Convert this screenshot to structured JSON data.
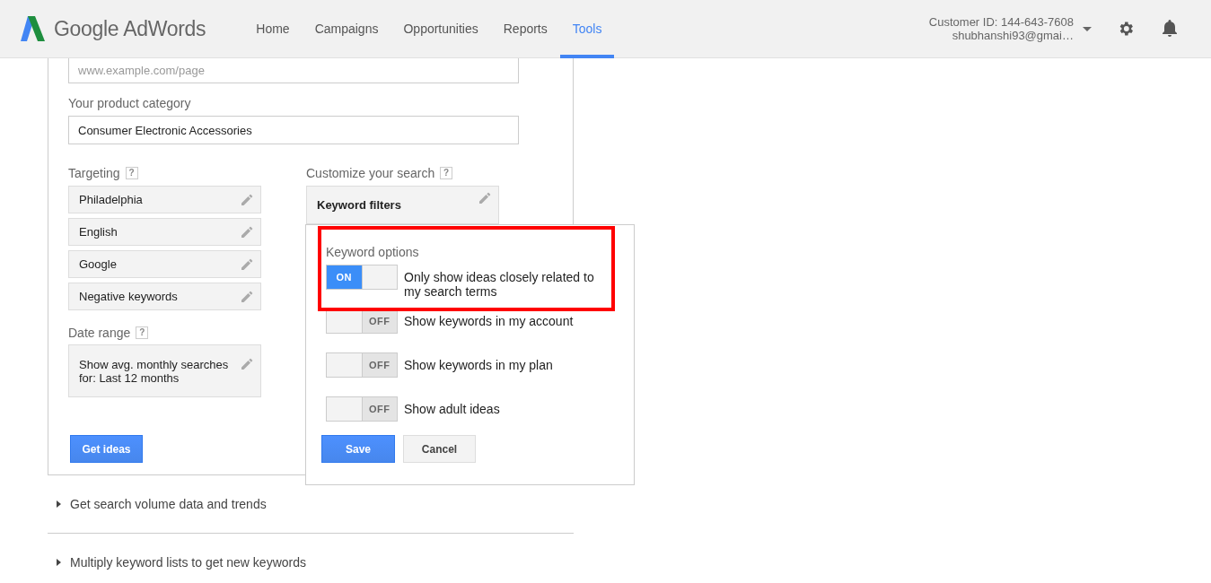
{
  "header": {
    "logo_text": "Google AdWords",
    "nav": [
      {
        "label": "Home",
        "selected": false
      },
      {
        "label": "Campaigns",
        "selected": false
      },
      {
        "label": "Opportunities",
        "selected": false
      },
      {
        "label": "Reports",
        "selected": false
      },
      {
        "label": "Tools",
        "selected": true
      }
    ],
    "customer_id": "Customer ID: 144-643-7608",
    "account": "shubhanshi93@gmai…"
  },
  "form": {
    "url_field": {
      "placeholder": "www.example.com/page"
    },
    "product_category": {
      "label": "Your product category",
      "value": "Consumer Electronic Accessories"
    },
    "targeting": {
      "label": "Targeting",
      "help": "?",
      "items": [
        "Philadelphia",
        "English",
        "Google",
        "Negative keywords"
      ]
    },
    "date_range": {
      "label": "Date range",
      "help": "?",
      "value": "Show avg. monthly searches for: Last 12 months"
    },
    "get_ideas_button": "Get ideas",
    "customize": {
      "label": "Customize your search",
      "help": "?",
      "filter_button": "Keyword filters"
    }
  },
  "keyword_options_popup": {
    "title": "Keyword options",
    "options": [
      {
        "label": "Only show ideas closely related to my search terms",
        "on": true,
        "toggle_text": "ON"
      },
      {
        "label": "Show keywords in my account",
        "on": false,
        "toggle_text": "OFF"
      },
      {
        "label": "Show keywords in my plan",
        "on": false,
        "toggle_text": "OFF"
      },
      {
        "label": "Show adult ideas",
        "on": false,
        "toggle_text": "OFF"
      }
    ],
    "save_button": "Save",
    "cancel_button": "Cancel"
  },
  "sections": [
    {
      "label": "Get search volume data and trends",
      "expanded": false
    },
    {
      "label": "Multiply keyword lists to get new keywords",
      "expanded": false
    }
  ]
}
